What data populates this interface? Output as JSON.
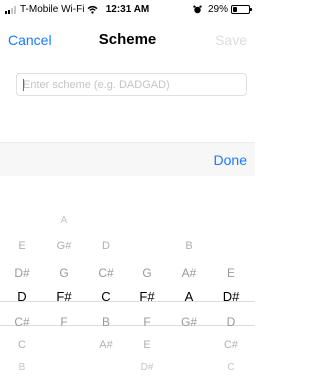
{
  "status_bar": {
    "carrier": "T-Mobile Wi-Fi",
    "time": "12:31 AM",
    "battery": "29%",
    "battery_level": 0.29,
    "icons": [
      "signal-icon",
      "wifi-icon",
      "alarm-icon",
      "battery-icon"
    ]
  },
  "nav": {
    "cancel_label": "Cancel",
    "title": "Scheme",
    "save_label": "Save"
  },
  "scheme_input": {
    "value": "",
    "placeholder": "Enter scheme (e.g. DADGAD)"
  },
  "toolbar": {
    "done_label": "Done"
  },
  "colors": {
    "accent": "#1a7bff",
    "disabled": "#dcdcdc",
    "placeholder": "#c4c4c4"
  },
  "picker": {
    "columns": [
      {
        "selected": "D",
        "rows": [
          "",
          "",
          "E",
          "D#",
          "D",
          "C#",
          "C",
          "B"
        ]
      },
      {
        "selected": "F#",
        "rows": [
          "",
          "A",
          "G#",
          "G",
          "F#",
          "F",
          "",
          ""
        ]
      },
      {
        "selected": "C",
        "rows": [
          "",
          "",
          "D",
          "C#",
          "C",
          "B",
          "A#",
          ""
        ]
      },
      {
        "selected": "F#",
        "rows": [
          "",
          "",
          "",
          "G",
          "F#",
          "F",
          "E",
          "D#"
        ]
      },
      {
        "selected": "A",
        "rows": [
          "",
          "",
          "B",
          "A#",
          "A",
          "G#",
          "",
          ""
        ]
      },
      {
        "selected": "D#",
        "rows": [
          "",
          "",
          "",
          "E",
          "D#",
          "D",
          "C#",
          "C"
        ]
      }
    ]
  }
}
